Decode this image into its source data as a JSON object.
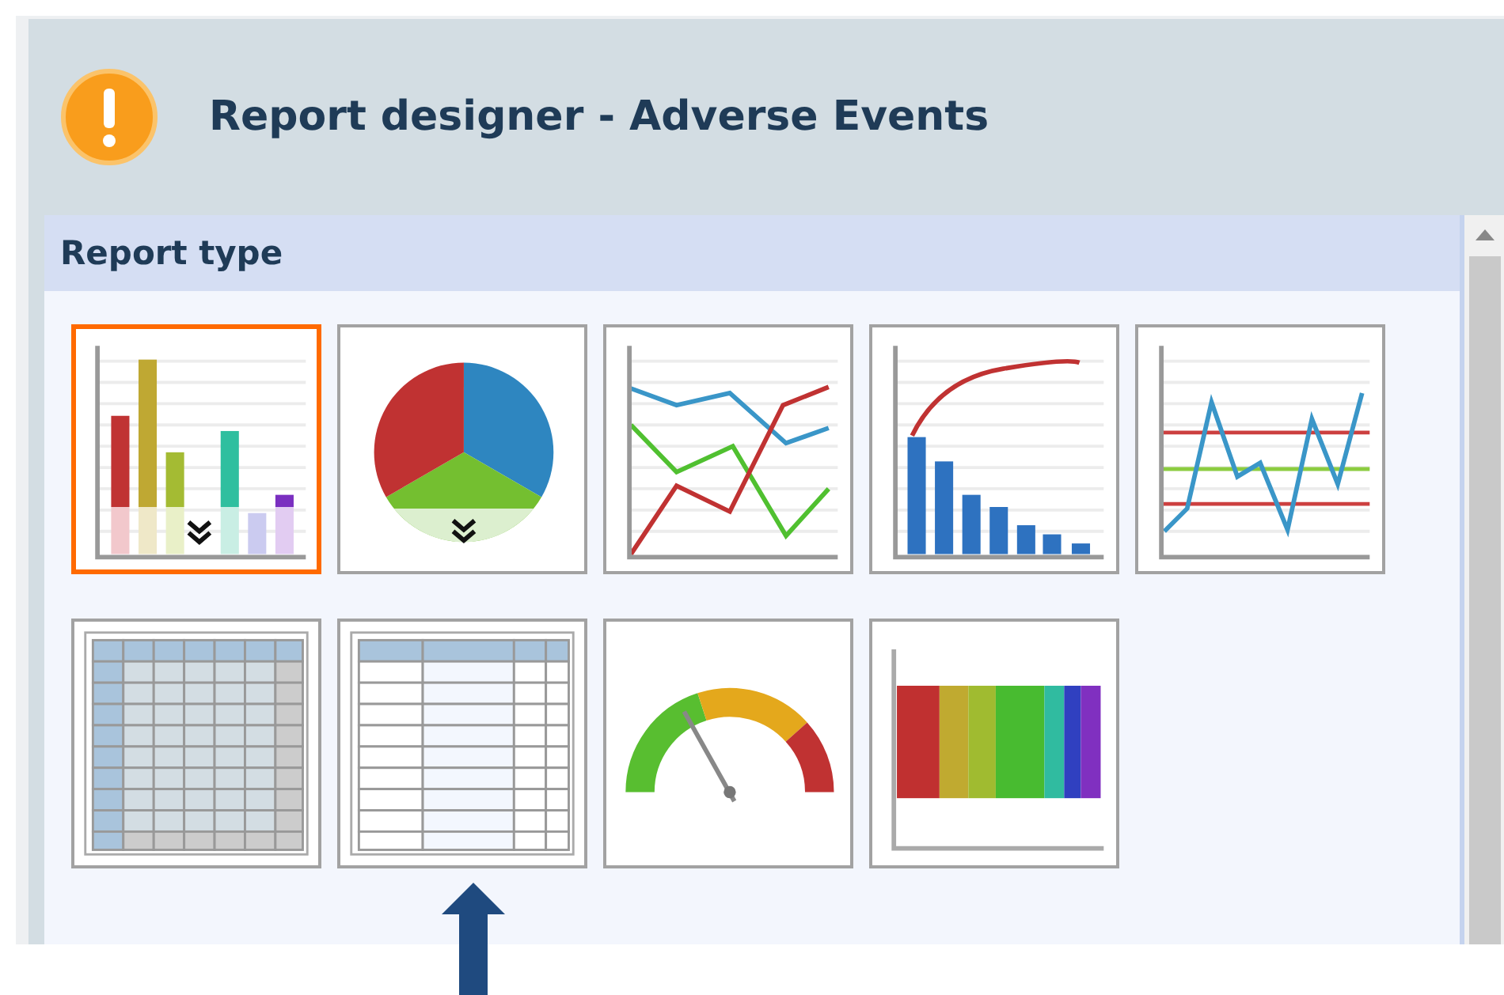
{
  "window": {
    "title": "Report designer - Adverse Events"
  },
  "section": {
    "title": "Report type"
  },
  "report_types": [
    {
      "kind": "bar",
      "selected": true
    },
    {
      "kind": "pie",
      "selected": false
    },
    {
      "kind": "line",
      "selected": false
    },
    {
      "kind": "pareto",
      "selected": false
    },
    {
      "kind": "control",
      "selected": false
    },
    {
      "kind": "grid",
      "selected": false
    },
    {
      "kind": "table",
      "selected": false
    },
    {
      "kind": "gauge",
      "selected": false
    },
    {
      "kind": "stacked",
      "selected": false
    }
  ]
}
